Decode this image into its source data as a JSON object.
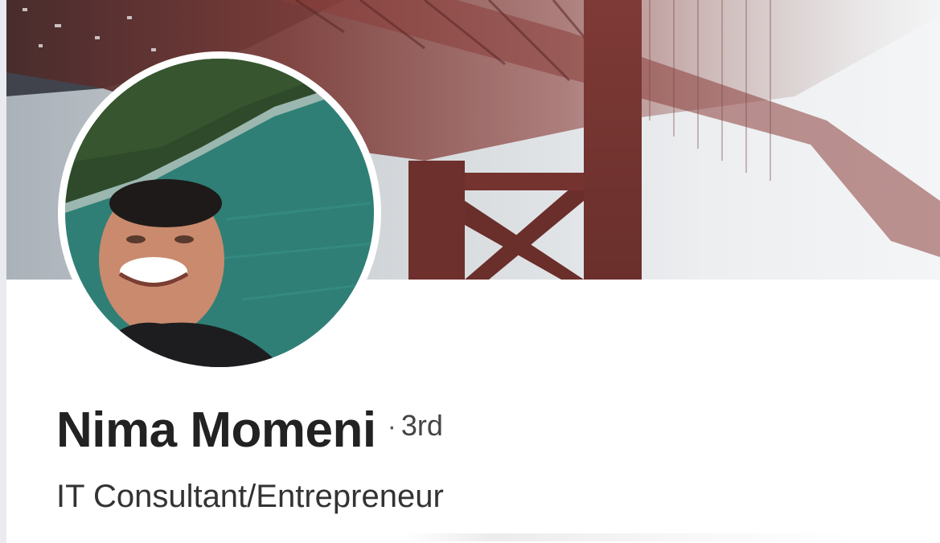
{
  "profile": {
    "name": "Nima Momeni",
    "separator": "·",
    "connection_degree": "3rd",
    "headline": "IT Consultant/Entrepreneur"
  },
  "colors": {
    "bridge_red": "#8a3a36",
    "cover_fog": "#eceef0",
    "water": "#2f7f76",
    "text_dark": "#222222"
  },
  "icons": {
    "cover_image": "bridge-cover-photo",
    "profile_image": "profile-photo"
  }
}
